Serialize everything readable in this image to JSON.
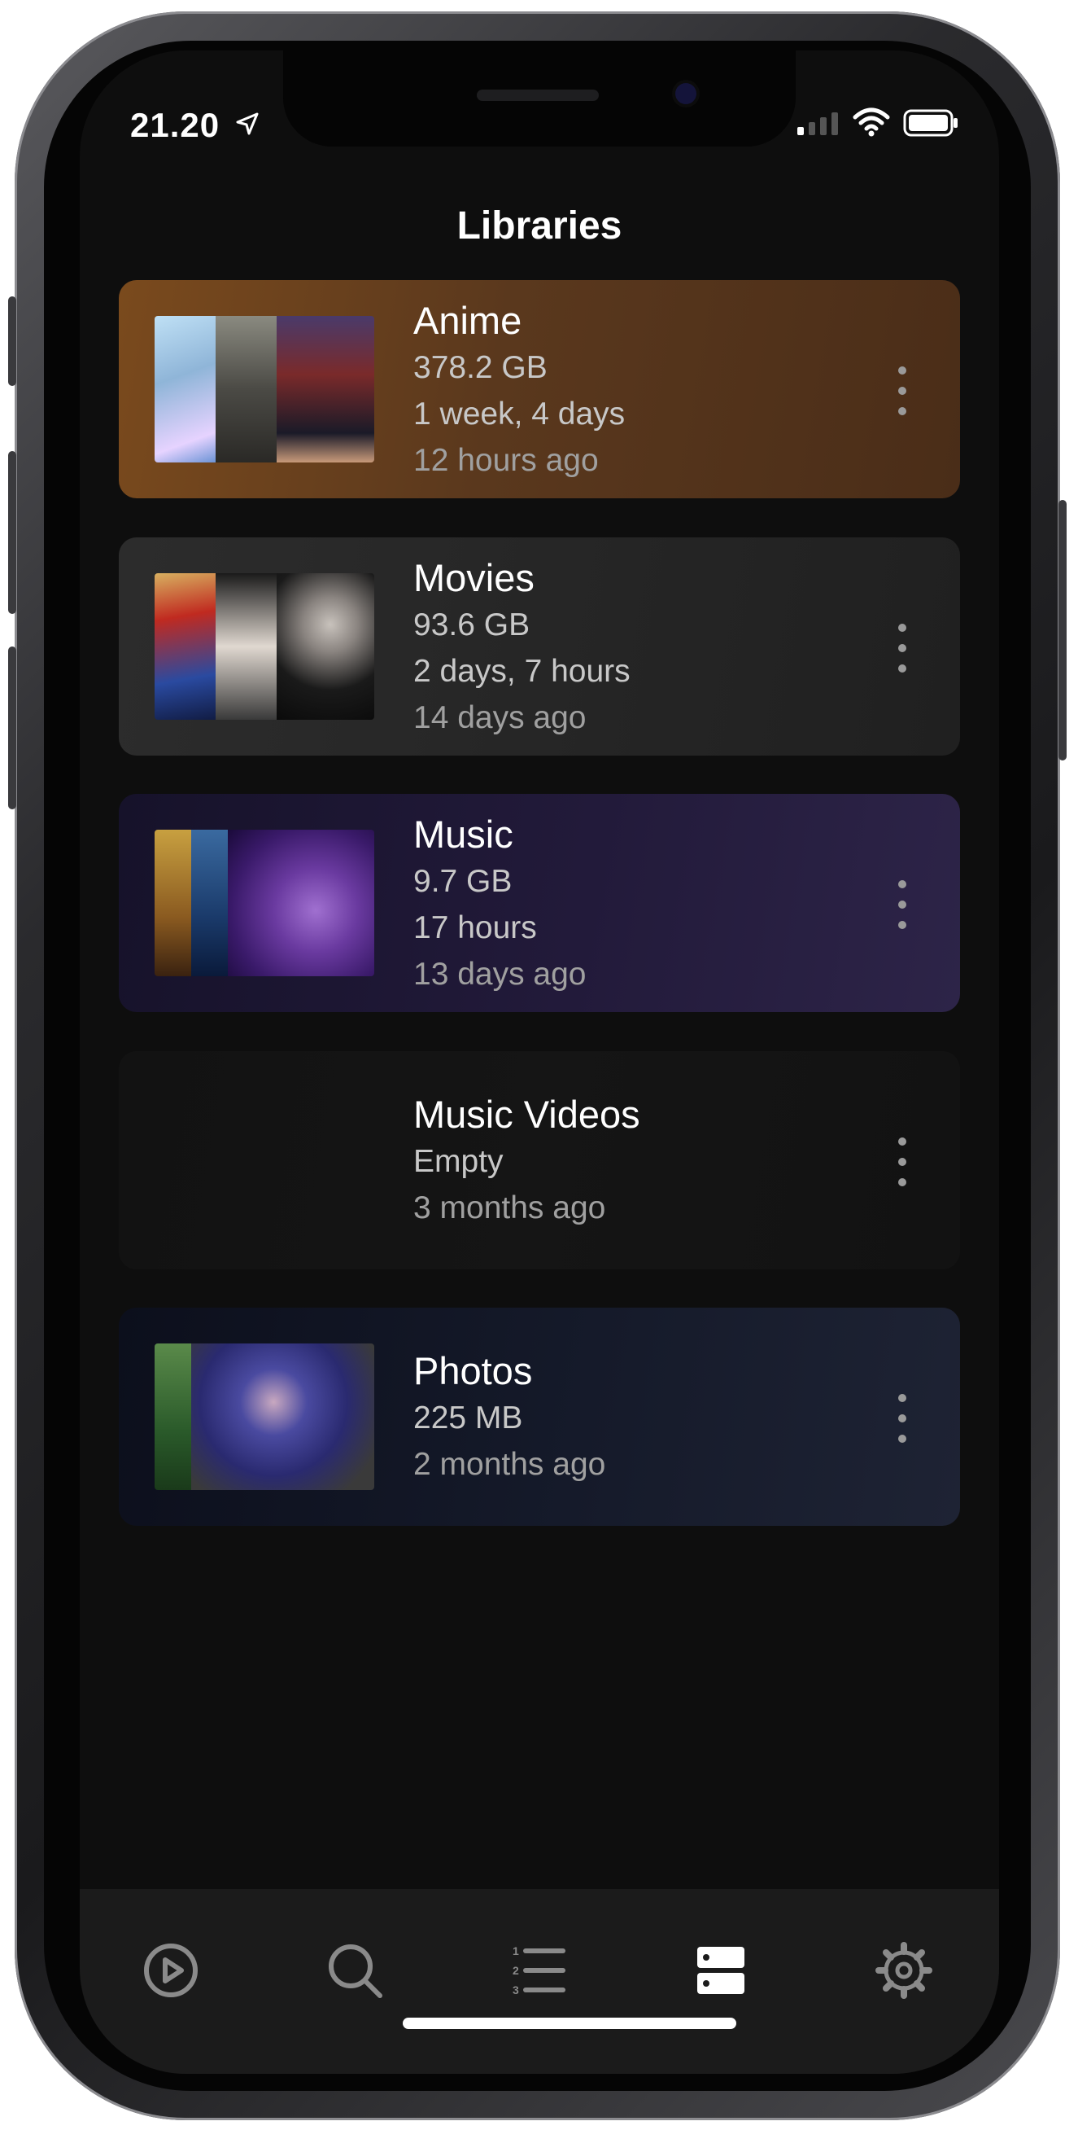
{
  "status_bar": {
    "time": "21.20",
    "location_icon": "location-arrow-icon",
    "signal_icon": "cellular-signal-icon",
    "wifi_icon": "wifi-icon",
    "battery_icon": "battery-icon"
  },
  "header": {
    "title": "Libraries"
  },
  "libraries": [
    {
      "name": "Anime",
      "size": "378.2 GB",
      "duration": "1 week, 4 days",
      "updated": "12 hours ago",
      "accent": "#7a4a1d"
    },
    {
      "name": "Movies",
      "size": "93.6 GB",
      "duration": "2 days, 7 hours",
      "updated": "14 days ago",
      "accent": "#2c2c2c"
    },
    {
      "name": "Music",
      "size": "9.7 GB",
      "duration": "17 hours",
      "updated": "13 days ago",
      "accent": "#221a3a"
    },
    {
      "name": "Music Videos",
      "size": "Empty",
      "updated": "3 months ago",
      "accent": "#141414"
    },
    {
      "name": "Photos",
      "size": "225 MB",
      "updated": "2 months ago",
      "accent": "#151a2a"
    }
  ],
  "tabbar": {
    "tabs": [
      {
        "icon": "play-circle-icon",
        "active": false
      },
      {
        "icon": "search-icon",
        "active": false
      },
      {
        "icon": "numbered-list-icon",
        "active": false
      },
      {
        "icon": "libraries-icon",
        "active": true
      },
      {
        "icon": "gear-icon",
        "active": false
      }
    ]
  }
}
